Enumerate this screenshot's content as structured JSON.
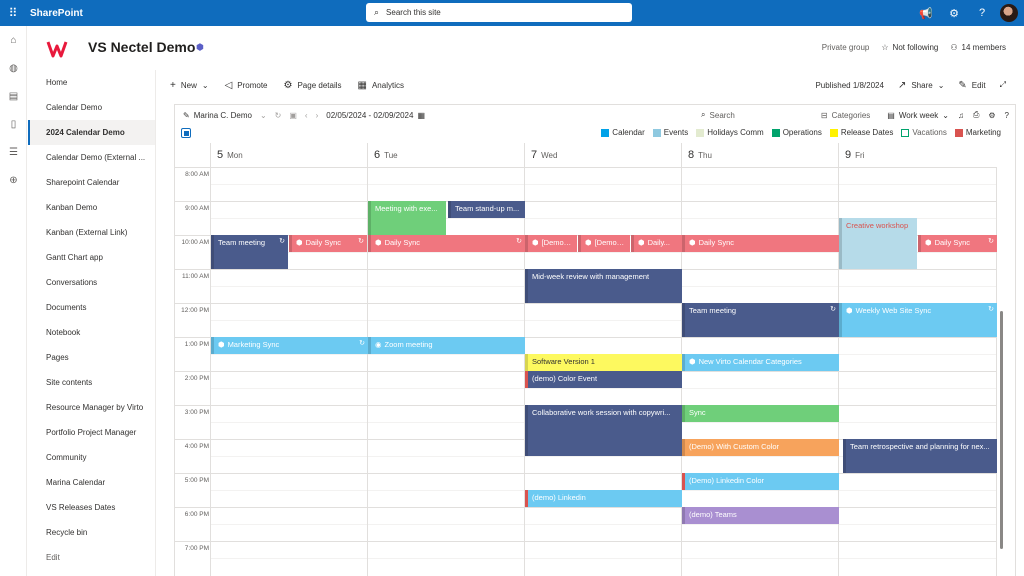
{
  "suite": {
    "app_name": "SharePoint",
    "search_placeholder": "Search this site"
  },
  "site": {
    "title": "VS Nectel Demo",
    "privacy": "Private group",
    "follow_label": "Not following",
    "members_label": "14 members"
  },
  "nav": {
    "items": [
      "Home",
      "Calendar Demo",
      "2024 Calendar Demo",
      "Calendar Demo (External ...",
      "Sharepoint Calendar",
      "Kanban Demo",
      "Kanban (External Link)",
      "Gantt Chart app",
      "Conversations",
      "Documents",
      "Notebook",
      "Pages",
      "Site contents",
      "Resource Manager by Virto",
      "Portfolio Project Manager",
      "Community",
      "Marina Calendar",
      "VS Releases Dates",
      "Recycle bin"
    ],
    "edit_label": "Edit"
  },
  "commands": {
    "new": "New",
    "promote": "Promote",
    "page_details": "Page details",
    "analytics": "Analytics",
    "published": "Published 1/8/2024",
    "share": "Share",
    "edit": "Edit"
  },
  "calendar": {
    "user": "Marina C. Demo",
    "date_range": "02/05/2024 - 02/09/2024",
    "search_placeholder": "Search",
    "categories_label": "Categories",
    "view_label": "Work week",
    "legend": [
      {
        "label": "Calendar",
        "color": "#00a2e8"
      },
      {
        "label": "Events",
        "color": "#8fc9e0"
      },
      {
        "label": "Holidays Comm",
        "color": "#e3ebd0"
      },
      {
        "label": "Operations",
        "color": "#00a36c"
      },
      {
        "label": "Release Dates",
        "color": "#fff200"
      },
      {
        "label": "Vacations",
        "color": "#ffffff"
      },
      {
        "label": "Marketing",
        "color": "#d9534f"
      }
    ],
    "days": [
      {
        "num": "5",
        "name": "Mon"
      },
      {
        "num": "6",
        "name": "Tue"
      },
      {
        "num": "7",
        "name": "Wed"
      },
      {
        "num": "8",
        "name": "Thu"
      },
      {
        "num": "9",
        "name": "Fri"
      }
    ],
    "hours": [
      "8:00 AM",
      "9:00 AM",
      "10:00 AM",
      "11:00 AM",
      "12:00 PM",
      "1:00 PM",
      "2:00 PM",
      "3:00 PM",
      "4:00 PM",
      "5:00 PM",
      "6:00 PM",
      "7:00 PM"
    ],
    "events": {
      "e1": "Meeting with exe...",
      "e2": "Team stand-up m...",
      "e3": "Team meeting",
      "e4": "Daily Sync",
      "e5": "Daily Sync",
      "e6": "[Demo] ...",
      "e7": "[Demo] ...",
      "e8": "Daily...",
      "e9": "Daily Sync",
      "e10": "Creative workshop",
      "e11": "Daily Sync",
      "e12": "Mid-week review with management",
      "e13": "Team meeting",
      "e14": "Weekly Web Site Sync",
      "e15": "Marketing Sync",
      "e16": "Zoom meeting",
      "e17": "Software Version 1",
      "e18": "New Virto Calendar Categories",
      "e19": "(demo) Color Event",
      "e20": "Collaborative work session with copywri...",
      "e21": "Sync",
      "e22": "(Demo) With Custom Color",
      "e23": "Team retrospective and planning for nex...",
      "e24": "(Demo) Linkedin Color",
      "e25": "(demo) Linkedin",
      "e26": "(demo) Teams"
    }
  },
  "colors": {
    "suite_blue": "#0f6cbd",
    "event_navy": "#4a5b8c",
    "event_salmon": "#f0767f",
    "event_sky": "#6ccaf2",
    "event_green": "#6fcf7a",
    "event_orange": "#f7a35c",
    "event_purple": "#a98fd1",
    "event_yellow": "#fdf95f",
    "event_lightblue": "#b6dbe9"
  }
}
